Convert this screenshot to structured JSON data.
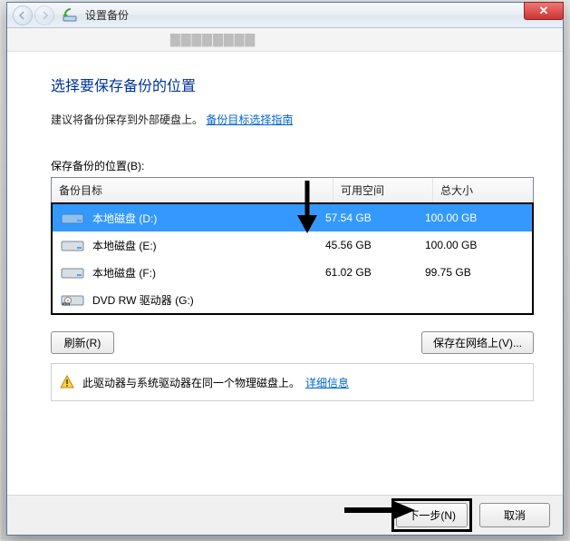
{
  "window": {
    "title": "设置备份",
    "close_glyph": "✕"
  },
  "content": {
    "heading": "选择要保存备份的位置",
    "recommendation_text": "建议将备份保存到外部硬盘上。",
    "guidelines_link": "备份目标选择指南",
    "list_label": "保存备份的位置(B):",
    "columns": {
      "name": "备份目标",
      "free": "可用空间",
      "total": "总大小"
    },
    "drives": [
      {
        "name": "本地磁盘 (D:)",
        "free": "57.54 GB",
        "total": "100.00 GB",
        "selected": true,
        "kind": "hdd"
      },
      {
        "name": "本地磁盘 (E:)",
        "free": "45.56 GB",
        "total": "100.00 GB",
        "selected": false,
        "kind": "hdd"
      },
      {
        "name": "本地磁盘 (F:)",
        "free": "61.02 GB",
        "total": "99.75 GB",
        "selected": false,
        "kind": "hdd"
      },
      {
        "name": "DVD RW 驱动器 (G:)",
        "free": "",
        "total": "",
        "selected": false,
        "kind": "dvd"
      }
    ],
    "refresh_label": "刷新(R)",
    "network_label": "保存在网络上(V)...",
    "warning_text": "此驱动器与系统驱动器在同一个物理磁盘上。",
    "details_link": "详细信息"
  },
  "footer": {
    "next_label": "下一步(N)",
    "cancel_label": "取消"
  }
}
